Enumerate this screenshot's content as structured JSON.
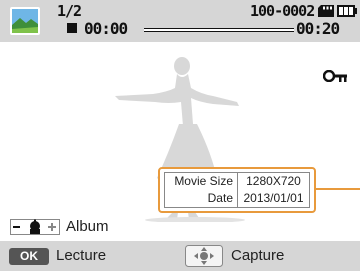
{
  "status_bar": {
    "sequence": "1/2",
    "elapsed_time": "00:00",
    "file_number": "100-0002",
    "total_time": "00:20",
    "playback_progress": 0.0
  },
  "info_panel": {
    "rows": [
      {
        "label": "Movie Size",
        "value": "1280X720"
      },
      {
        "label": "Date",
        "value": "2013/01/01"
      }
    ]
  },
  "controls": {
    "zoom_label": "Album",
    "ok_key": "OK",
    "ok_label": "Lecture",
    "dpad_label": "Capture"
  },
  "icons": {
    "thumbnail": "landscape-thumbnail-icon",
    "stop": "stop-icon",
    "card": "memory-card-icon",
    "battery": "battery-full-icon",
    "protect": "key-icon",
    "zoom": "zoom-lever-icon",
    "dpad": "dpad-icon"
  },
  "colors": {
    "bar_background": "#d6d6d6",
    "callout": "#e89a3c",
    "figure": "#d8d8d8"
  }
}
